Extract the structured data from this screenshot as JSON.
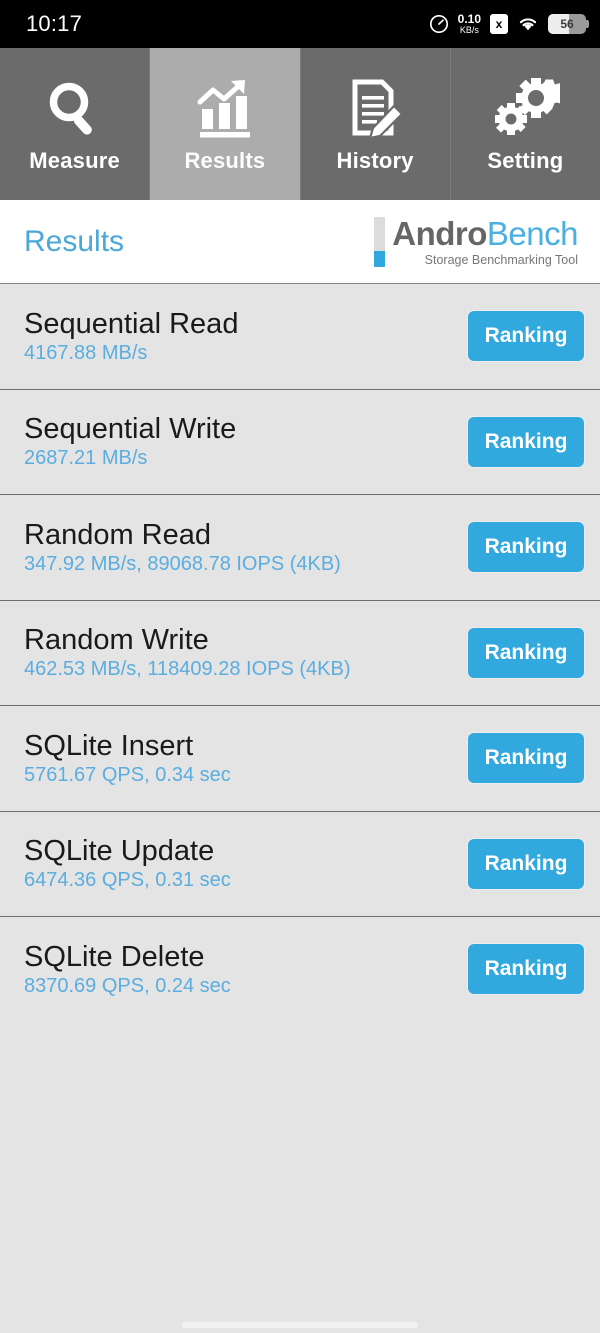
{
  "status_bar": {
    "time": "10:17",
    "network_speed_value": "0.10",
    "network_speed_unit": "KB/s",
    "sim_icon_label": "x",
    "battery_percent": "56",
    "icons": [
      "speedometer-icon",
      "sim-disabled-icon",
      "wifi-icon",
      "battery-icon"
    ]
  },
  "tabs": [
    {
      "label": "Measure",
      "icon": "magnifier-icon",
      "selected": false
    },
    {
      "label": "Results",
      "icon": "bar-chart-arrow-icon",
      "selected": true
    },
    {
      "label": "History",
      "icon": "document-pencil-icon",
      "selected": false
    },
    {
      "label": "Setting",
      "icon": "gears-icon",
      "selected": false
    }
  ],
  "header": {
    "title": "Results",
    "logo_primary": "Andro",
    "logo_secondary": "Bench",
    "logo_subtitle": "Storage Benchmarking Tool"
  },
  "results": [
    {
      "name": "Sequential Read",
      "value": "4167.88 MB/s",
      "action": "Ranking"
    },
    {
      "name": "Sequential Write",
      "value": "2687.21 MB/s",
      "action": "Ranking"
    },
    {
      "name": "Random Read",
      "value": "347.92 MB/s, 89068.78 IOPS (4KB)",
      "action": "Ranking"
    },
    {
      "name": "Random Write",
      "value": "462.53 MB/s, 118409.28 IOPS (4KB)",
      "action": "Ranking"
    },
    {
      "name": "SQLite Insert",
      "value": "5761.67 QPS, 0.34 sec",
      "action": "Ranking"
    },
    {
      "name": "SQLite Update",
      "value": "6474.36 QPS, 0.31 sec",
      "action": "Ranking"
    },
    {
      "name": "SQLite Delete",
      "value": "8370.69 QPS, 0.24 sec",
      "action": "Ranking"
    }
  ],
  "colors": {
    "accent_blue": "#31a8de",
    "value_blue": "#5bade0",
    "title_blue": "#4aa8d8",
    "tab_bg": "#6b6b6b",
    "tab_selected_bg": "#abacab",
    "list_bg": "#e4e4e4"
  }
}
